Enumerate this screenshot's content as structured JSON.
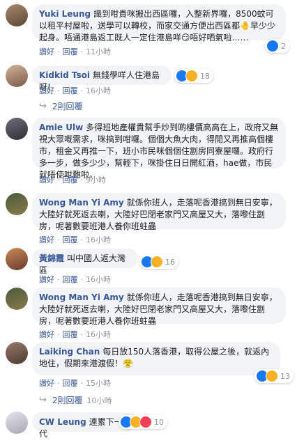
{
  "actions": {
    "like_label": "讚好",
    "reply_label": "回覆"
  },
  "comments": [
    {
      "author": "Yuki Leung",
      "text": "識到咁貴咪搬出西區囉，入整新界囉，8500蚊可以租平村屋啦，送學可以轉校，而家交通方便出西區都🤚早少少起身。唔通港島返工既人一定住港島咩😏唔好哂氣啦……",
      "time": "11小時",
      "reaction_count": "2",
      "reactions": [
        "like-icon"
      ]
    },
    {
      "author": "Kidkid Tsoi",
      "text": "無錢學咩人住港島呀!",
      "time": "16小時",
      "reaction_count": "18",
      "reactions": [
        "like-icon",
        "haha-icon"
      ]
    },
    {
      "author": "Amie Ulw",
      "text": "多得班地產權貴幫手炒到啲樓價高高在上，政府又無視大眾嘅需求，咪搞到咁囉。個個大魚大肉，得閒又再推高個樓市，租金又再推一下，班小市民咪個個住劏房同寮屋囉。政府行多一步，做多少少，幫輕下，咪掛住日日開紅酒，hae做，市民就唔使咁難啦。",
      "time": "9小時"
    },
    {
      "author": "Wong Man Yi Amy",
      "text": "就係你班人，走落呢香港搞到無日安寧，大陸好就死返去喇，大陸好巴閉老家門又高屋又大，落嚟住劏房，呢著數要班港人養你班蛀蟲",
      "time": "16小時"
    },
    {
      "author": "黃錦霞",
      "text": "叫中國人返大灣區",
      "time": "16小時",
      "reaction_count": "16",
      "reactions": [
        "like-icon",
        "sad-icon"
      ]
    },
    {
      "author": "Wong Man Yi Amy",
      "text": "就係你班人，走落呢香港搞到無日安寧，大陸好就死返去喇，大陸好巴閉老家門又高屋又大，落嚟住劏房，呢著數要班港人養你班蛀蟲",
      "time": "16小時"
    },
    {
      "author": "Laiking Chan",
      "text": "每日放150人落香港，取得公屋之後，就返內地住，假期來港渡假！😤",
      "time": "15小時",
      "reaction_count": "13",
      "reactions": [
        "like-icon",
        "haha-icon"
      ]
    },
    {
      "author": "CW Leung",
      "text": "連累下一代",
      "reaction_count": "10",
      "reactions": [
        "like-icon",
        "sad-icon",
        "love-icon"
      ]
    }
  ],
  "reply_threads": [
    {
      "label": "2則回覆"
    },
    {
      "label": "2則回覆",
      "time": "10小時"
    }
  ]
}
